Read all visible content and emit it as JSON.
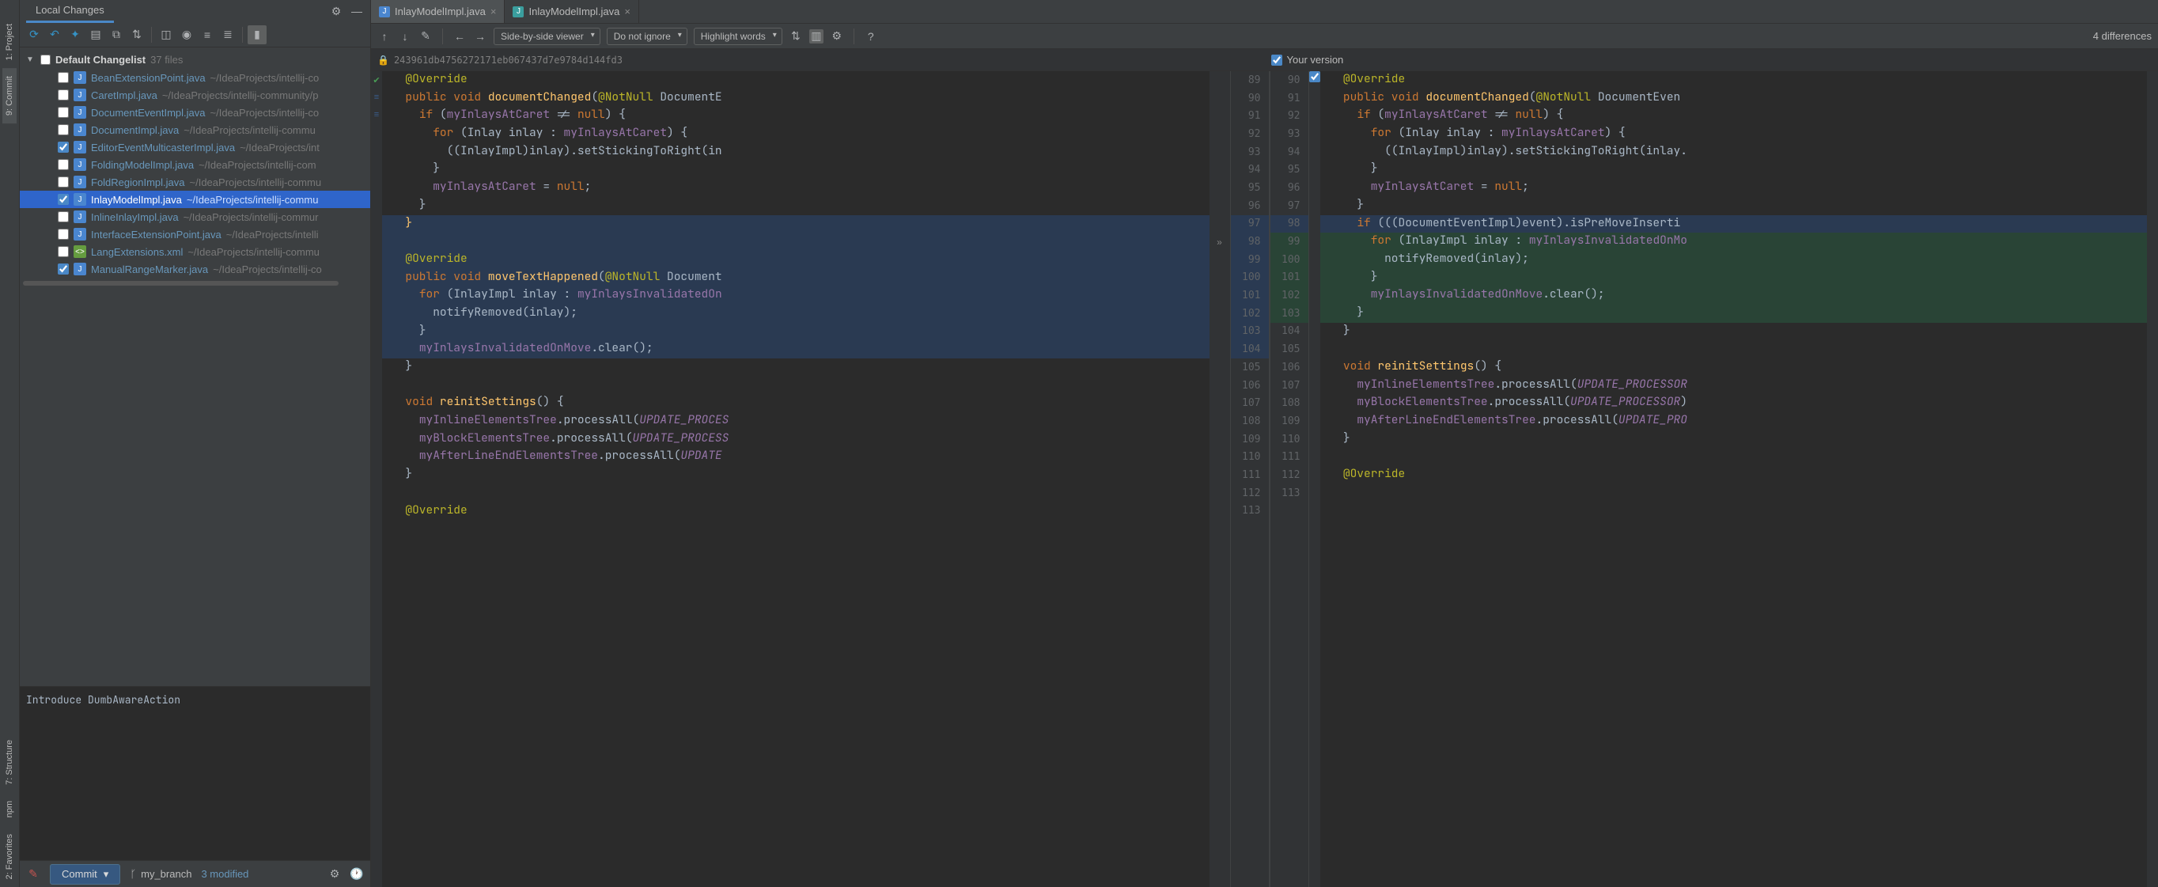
{
  "left_rail": {
    "items": [
      "1: Project",
      "9: Commit",
      "7: Structure",
      "npm",
      "2: Favorites"
    ]
  },
  "commit_panel": {
    "title": "Local Changes",
    "changelist_name": "Default Changelist",
    "changelist_count": "37 files",
    "files": [
      {
        "checked": false,
        "icon": "java",
        "name": "BeanExtensionPoint.java",
        "path": "~/IdeaProjects/intellij-co"
      },
      {
        "checked": false,
        "icon": "java",
        "name": "CaretImpl.java",
        "path": "~/IdeaProjects/intellij-community/p"
      },
      {
        "checked": false,
        "icon": "java",
        "name": "DocumentEventImpl.java",
        "path": "~/IdeaProjects/intellij-co"
      },
      {
        "checked": false,
        "icon": "java",
        "name": "DocumentImpl.java",
        "path": "~/IdeaProjects/intellij-commu"
      },
      {
        "checked": true,
        "icon": "java",
        "name": "EditorEventMulticasterImpl.java",
        "path": "~/IdeaProjects/int"
      },
      {
        "checked": false,
        "icon": "java",
        "name": "FoldingModelImpl.java",
        "path": "~/IdeaProjects/intellij-com"
      },
      {
        "checked": false,
        "icon": "java",
        "name": "FoldRegionImpl.java",
        "path": "~/IdeaProjects/intellij-commu"
      },
      {
        "checked": true,
        "icon": "java",
        "name": "InlayModelImpl.java",
        "path": "~/IdeaProjects/intellij-commu",
        "selected": true
      },
      {
        "checked": false,
        "icon": "java",
        "name": "InlineInlayImpl.java",
        "path": "~/IdeaProjects/intellij-commur"
      },
      {
        "checked": false,
        "icon": "java",
        "name": "InterfaceExtensionPoint.java",
        "path": "~/IdeaProjects/intelli"
      },
      {
        "checked": false,
        "icon": "xml",
        "name": "LangExtensions.xml",
        "path": "~/IdeaProjects/intellij-commu"
      },
      {
        "checked": true,
        "icon": "java",
        "name": "ManualRangeMarker.java",
        "path": "~/IdeaProjects/intellij-co"
      }
    ],
    "commit_message": "Introduce DumbAwareAction",
    "commit_button": "Commit",
    "branch": "my_branch",
    "modified": "3 modified"
  },
  "tabs": [
    {
      "icon": "java-blue",
      "name": "InlayModelImpl.java",
      "active": true
    },
    {
      "icon": "java-teal",
      "name": "InlayModelImpl.java",
      "active": false
    }
  ],
  "diff_toolbar": {
    "viewer": "Side-by-side viewer",
    "ignore": "Do not ignore",
    "highlight": "Highlight words",
    "count": "4 differences"
  },
  "diff_header": {
    "left_hash": "243961db4756272171eb067437d7e9784d144fd3",
    "right_label": "Your version"
  },
  "left_code": [
    {
      "n": 89,
      "html": "  <span class='c-anno'>@Override</span>"
    },
    {
      "n": 90,
      "html": "  <span class='c-kw'>public void</span> <span class='c-fn'>documentChanged</span>(<span class='c-anno'>@NotNull</span> <span class='c-type'>DocumentE</span>"
    },
    {
      "n": 91,
      "html": "    <span class='c-kw'>if</span> (<span class='c-field'>myInlaysAtCaret</span> != <span class='c-kw'>null</span>) {"
    },
    {
      "n": 92,
      "html": "      <span class='c-kw'>for</span> (<span class='c-type'>Inlay</span> inlay : <span class='c-field'>myInlaysAtCaret</span>) {"
    },
    {
      "n": 93,
      "html": "        ((InlayImpl)inlay).setStickingToRight(in"
    },
    {
      "n": 94,
      "html": "      }"
    },
    {
      "n": 95,
      "html": "      <span class='c-field'>myInlaysAtCaret</span> = <span class='c-kw'>null</span>;"
    },
    {
      "n": 96,
      "html": "    }"
    },
    {
      "n": 97,
      "html": "  <span class='c-fn'>}</span>",
      "bg": "blue"
    },
    {
      "n": 98,
      "html": "",
      "bg": "blue",
      "expand": true
    },
    {
      "n": 99,
      "html": "  <span class='c-anno'>@Override</span>",
      "bg": "blue"
    },
    {
      "n": 100,
      "html": "  <span class='c-kw'>public void</span> <span class='c-fn'>moveTextHappened</span>(<span class='c-anno'>@NotNull</span> <span class='c-type'>Document</span>",
      "bg": "blue"
    },
    {
      "n": 101,
      "html": "    <span class='c-kw'>for</span> (<span class='c-type'>InlayImpl</span> inlay : <span class='c-field'>myInlaysInvalidatedOn</span>",
      "bg": "blue"
    },
    {
      "n": 102,
      "html": "      notifyRemoved(inlay);",
      "bg": "blue"
    },
    {
      "n": 103,
      "html": "    }",
      "bg": "blue"
    },
    {
      "n": 104,
      "html": "    <span class='c-field'>myInlaysInvalidatedOnMove</span>.clear();",
      "bg": "blue"
    },
    {
      "n": 105,
      "html": "  }"
    },
    {
      "n": 106,
      "html": ""
    },
    {
      "n": 107,
      "html": "  <span class='c-kw'>void</span> <span class='c-fn'>reinitSettings</span>() {"
    },
    {
      "n": 108,
      "html": "    <span class='c-field'>myInlineElementsTree</span>.processAll(<span class='c-const'>UPDATE_PROCES</span>"
    },
    {
      "n": 109,
      "html": "    <span class='c-field'>myBlockElementsTree</span>.processAll(<span class='c-const'>UPDATE_PROCESS</span>"
    },
    {
      "n": 110,
      "html": "    <span class='c-field'>myAfterLineEndElementsTree</span>.processAll(<span class='c-const'>UPDATE</span>"
    },
    {
      "n": 111,
      "html": "  }"
    },
    {
      "n": 112,
      "html": ""
    },
    {
      "n": 113,
      "html": "  <span class='c-anno'>@Override</span>"
    }
  ],
  "right_code": [
    {
      "n": 90,
      "html": "  <span class='c-anno'>@Override</span>"
    },
    {
      "n": 91,
      "html": "  <span class='c-kw'>public void</span> <span class='c-fn'>documentChanged</span>(<span class='c-anno'>@NotNull</span> <span class='c-type'>DocumentEven</span>"
    },
    {
      "n": 92,
      "html": "    <span class='c-kw'>if</span> (<span class='c-field'>myInlaysAtCaret</span> != <span class='c-kw'>null</span>) {"
    },
    {
      "n": 93,
      "html": "      <span class='c-kw'>for</span> (<span class='c-type'>Inlay</span> inlay : <span class='c-field'>myInlaysAtCaret</span>) {"
    },
    {
      "n": 94,
      "html": "        ((InlayImpl)inlay).setStickingToRight(inlay."
    },
    {
      "n": 95,
      "html": "      }"
    },
    {
      "n": 96,
      "html": "      <span class='c-field'>myInlaysAtCaret</span> = <span class='c-kw'>null</span>;"
    },
    {
      "n": 97,
      "html": "    }"
    },
    {
      "n": 98,
      "html": "    <span class='c-kw'>if</span> (((DocumentEventImpl)event).isPreMoveInserti",
      "bg": "blue",
      "checkbox": true
    },
    {
      "n": 99,
      "html": "      <span class='c-kw'>for</span> (<span class='c-type'>InlayImpl</span> inlay : <span class='c-field'>myInlaysInvalidatedOnMo</span>",
      "bg": "green"
    },
    {
      "n": 100,
      "html": "        notifyRemoved(inlay);",
      "bg": "green"
    },
    {
      "n": 101,
      "html": "      }",
      "bg": "green"
    },
    {
      "n": 102,
      "html": "      <span class='c-field'>myInlaysInvalidatedOnMove</span>.clear();",
      "bg": "green"
    },
    {
      "n": 103,
      "html": "    }",
      "bg": "green"
    },
    {
      "n": 104,
      "html": "  }"
    },
    {
      "n": 105,
      "html": ""
    },
    {
      "n": 106,
      "html": "  <span class='c-kw'>void</span> <span class='c-fn'>reinitSettings</span>() {"
    },
    {
      "n": 107,
      "html": "    <span class='c-field'>myInlineElementsTree</span>.processAll(<span class='c-const'>UPDATE_PROCESSOR</span>"
    },
    {
      "n": 108,
      "html": "    <span class='c-field'>myBlockElementsTree</span>.processAll(<span class='c-const'>UPDATE_PROCESSOR</span>)"
    },
    {
      "n": 109,
      "html": "    <span class='c-field'>myAfterLineEndElementsTree</span>.processAll(<span class='c-const'>UPDATE_PRO</span>"
    },
    {
      "n": 110,
      "html": "  }"
    },
    {
      "n": 111,
      "html": ""
    },
    {
      "n": 112,
      "html": "  <span class='c-anno'>@Override</span>"
    },
    {
      "n": 113,
      "html": ""
    }
  ]
}
